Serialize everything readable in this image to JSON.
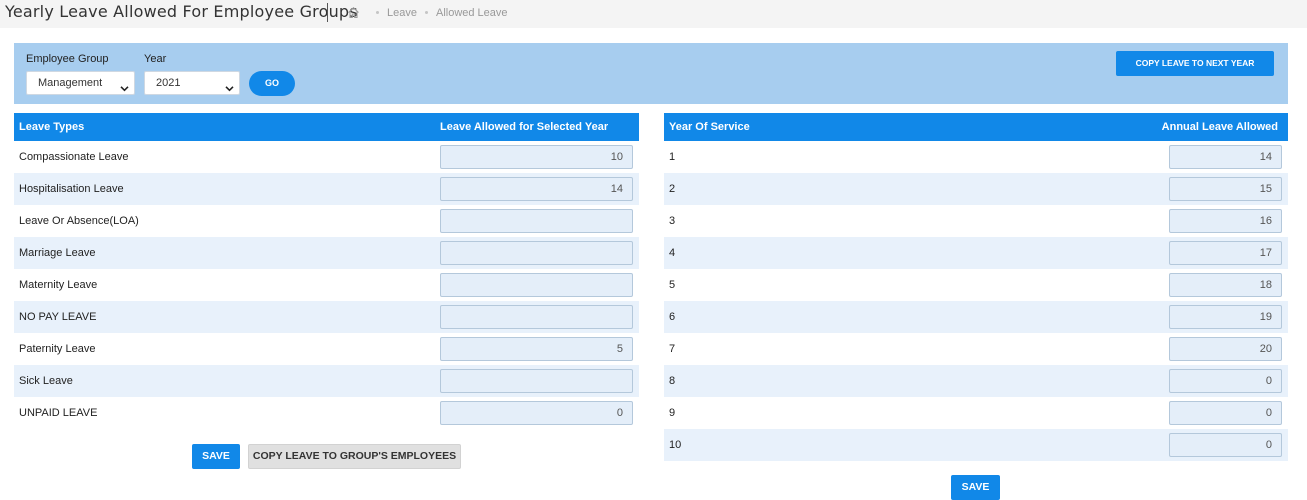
{
  "header": {
    "title": "Yearly Leave Allowed For Employee Groups",
    "breadcrumb": [
      "Leave",
      "Allowed Leave"
    ]
  },
  "filters": {
    "employee_group_label": "Employee Group",
    "employee_group_value": "Management",
    "year_label": "Year",
    "year_value": "2021",
    "go_label": "GO",
    "copy_next_year_label": "COPY LEAVE TO NEXT YEAR"
  },
  "leave_table": {
    "headers": [
      "Leave Types",
      "Leave Allowed for Selected Year"
    ],
    "rows": [
      {
        "type": "Compassionate Leave",
        "value": "10"
      },
      {
        "type": "Hospitalisation Leave",
        "value": "14"
      },
      {
        "type": "Leave Or Absence(LOA)",
        "value": ""
      },
      {
        "type": "Marriage Leave",
        "value": ""
      },
      {
        "type": "Maternity Leave",
        "value": ""
      },
      {
        "type": "NO PAY LEAVE",
        "value": ""
      },
      {
        "type": "Paternity Leave",
        "value": "5"
      },
      {
        "type": "Sick Leave",
        "value": ""
      },
      {
        "type": "UNPAID LEAVE",
        "value": "0"
      }
    ],
    "save_label": "SAVE",
    "copy_label": "COPY LEAVE TO GROUP'S EMPLOYEES"
  },
  "service_table": {
    "headers": [
      "Year Of Service",
      "Annual Leave Allowed"
    ],
    "rows": [
      {
        "year": "1",
        "value": "14"
      },
      {
        "year": "2",
        "value": "15"
      },
      {
        "year": "3",
        "value": "16"
      },
      {
        "year": "4",
        "value": "17"
      },
      {
        "year": "5",
        "value": "18"
      },
      {
        "year": "6",
        "value": "19"
      },
      {
        "year": "7",
        "value": "20"
      },
      {
        "year": "8",
        "value": "0"
      },
      {
        "year": "9",
        "value": "0"
      },
      {
        "year": "10",
        "value": "0"
      }
    ],
    "save_label": "SAVE"
  },
  "colors": {
    "accent": "#1188e8",
    "filter_bar": "#a7cdef",
    "row_alt": "#e8f1fb",
    "field_bg": "#e4eef9"
  }
}
